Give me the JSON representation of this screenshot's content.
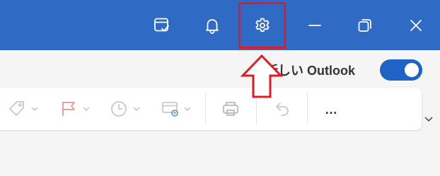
{
  "titlebar": {
    "color": "#2f6ac4",
    "buttons": [
      {
        "icon": "calendar-check-icon"
      },
      {
        "icon": "bell-icon"
      },
      {
        "icon": "gear-icon",
        "highlighted": true
      },
      {
        "icon": "minimize-icon"
      },
      {
        "icon": "restore-icon"
      },
      {
        "icon": "close-icon"
      }
    ]
  },
  "annotation": {
    "box_color": "#e01b24",
    "arrow_direction": "up"
  },
  "new_outlook": {
    "label": "新しい Outlook",
    "toggle_on": true,
    "toggle_color": "#1f63c6"
  },
  "ribbon": {
    "items": [
      {
        "icon": "tag-icon",
        "has_dropdown": true
      },
      {
        "icon": "flag-icon",
        "has_dropdown": true
      },
      {
        "icon": "clock-icon",
        "has_dropdown": true
      },
      {
        "icon": "rules-settings-icon",
        "has_dropdown": true
      },
      {
        "icon": "printer-icon"
      },
      {
        "icon": "undo-icon"
      },
      {
        "icon": "more-icon",
        "label": "…"
      }
    ]
  }
}
